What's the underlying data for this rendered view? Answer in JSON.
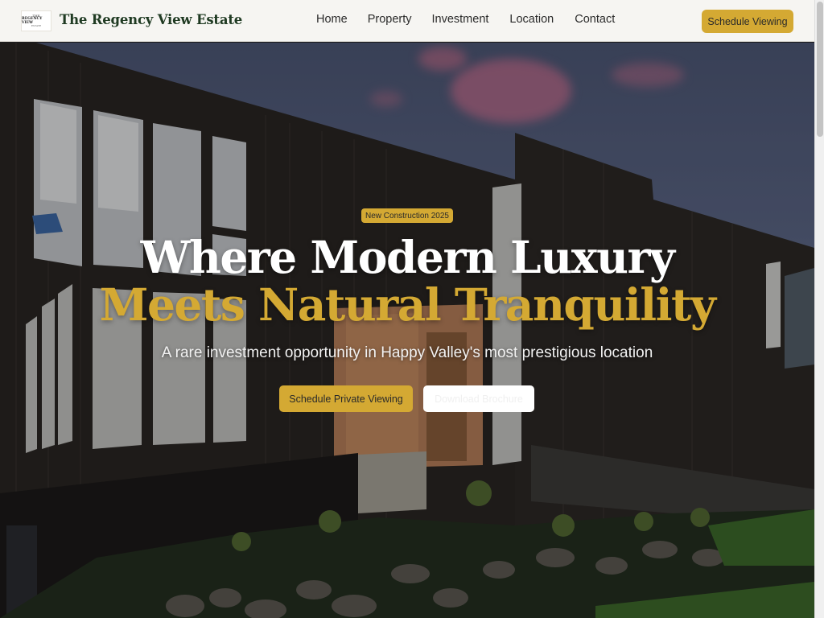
{
  "header": {
    "logo": {
      "line1": "THE",
      "line2": "REGENCY VIEW",
      "line3": "ESTATE"
    },
    "brand": "The Regency View Estate",
    "nav": [
      "Home",
      "Property",
      "Investment",
      "Location",
      "Contact"
    ],
    "cta": "Schedule Viewing"
  },
  "hero": {
    "badge": "New Construction 2025",
    "title_line1": "Where Modern Luxury",
    "title_line2": "Meets Natural Tranquility",
    "subtitle": "A rare investment opportunity in Happy Valley's most prestigious location",
    "primary_button": "Schedule Private Viewing",
    "secondary_button": "Download Brochure"
  },
  "colors": {
    "accent": "#d4a933",
    "brand_text": "#1f3a22",
    "nav_bg": "#f6f5f2"
  }
}
